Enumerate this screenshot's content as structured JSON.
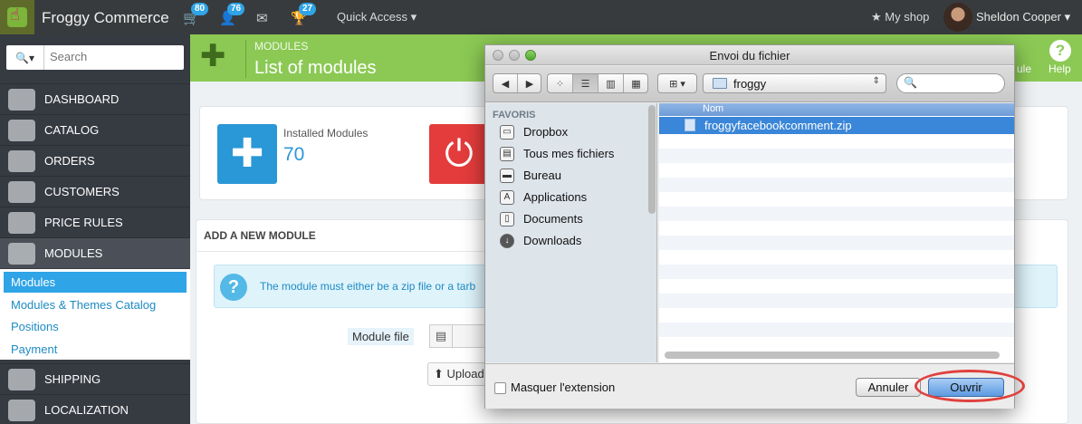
{
  "topbar": {
    "brand": "Froggy Commerce",
    "orders_badge": "80",
    "customers_badge": "76",
    "messages_badge": "",
    "trophy_badge": "27",
    "quick_access": "Quick Access",
    "my_shop": "My shop",
    "user_name": "Sheldon Cooper"
  },
  "sidebar": {
    "search_placeholder": "Search",
    "items": [
      {
        "label": "DASHBOARD"
      },
      {
        "label": "CATALOG"
      },
      {
        "label": "ORDERS"
      },
      {
        "label": "CUSTOMERS"
      },
      {
        "label": "PRICE RULES"
      },
      {
        "label": "MODULES"
      },
      {
        "label": "SHIPPING"
      },
      {
        "label": "LOCALIZATION"
      }
    ],
    "submenu": [
      {
        "label": "Modules"
      },
      {
        "label": "Modules & Themes Catalog"
      },
      {
        "label": "Positions"
      },
      {
        "label": "Payment"
      }
    ]
  },
  "header": {
    "breadcrumb": "MODULES",
    "title": "List of modules",
    "action_partial": "ule",
    "help_label": "Help"
  },
  "stats": {
    "installed_label": "Installed Modules",
    "installed_value": "70"
  },
  "add_module": {
    "heading": "ADD A NEW MODULE",
    "info_text": "The module must either be a zip file or a tarb",
    "file_label": "Module file",
    "upload_label": "Upload"
  },
  "dialog": {
    "title": "Envoi du fichier",
    "folder": "froggy",
    "sidebar_heading": "FAVORIS",
    "favorites": [
      {
        "label": "Dropbox"
      },
      {
        "label": "Tous mes fichiers"
      },
      {
        "label": "Bureau"
      },
      {
        "label": "Applications"
      },
      {
        "label": "Documents"
      },
      {
        "label": "Downloads"
      }
    ],
    "column_name": "Nom",
    "files": [
      {
        "name": "froggyfacebookcomment.zip",
        "selected": true
      }
    ],
    "hide_extension_label": "Masquer l'extension",
    "cancel_label": "Annuler",
    "open_label": "Ouvrir"
  },
  "colors": {
    "header_green": "#8bc954",
    "sidebar_dark": "#363a41",
    "accent_blue": "#2fa4e6",
    "highlight_red": "#e0403d"
  }
}
